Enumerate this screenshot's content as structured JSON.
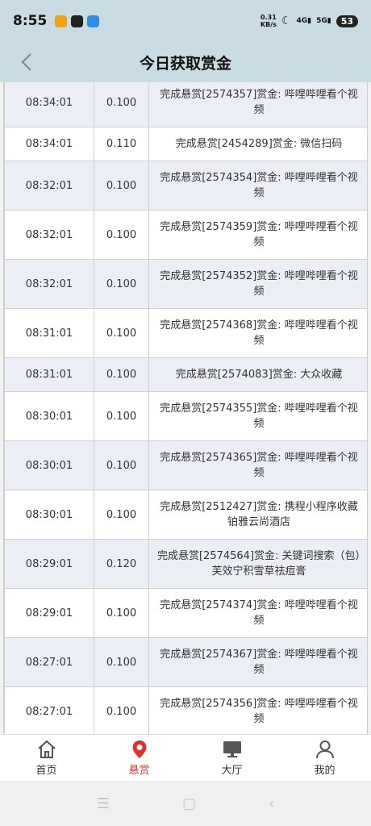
{
  "status_bar": {
    "time": "8:55",
    "net_speed_value": "0.31",
    "net_speed_unit": "KB/s",
    "signal_1": "4G",
    "signal_2": "5G",
    "battery": "53"
  },
  "header": {
    "title": "今日获取赏金"
  },
  "rows": [
    {
      "time": "08:34:01",
      "amount": "0.100",
      "desc": "完成悬赏[2574357]赏金: 哔哩哔哩看个视频"
    },
    {
      "time": "08:34:01",
      "amount": "0.110",
      "desc": "完成悬赏[2454289]赏金: 微信扫码"
    },
    {
      "time": "08:32:01",
      "amount": "0.100",
      "desc": "完成悬赏[2574354]赏金: 哔哩哔哩看个视频"
    },
    {
      "time": "08:32:01",
      "amount": "0.100",
      "desc": "完成悬赏[2574359]赏金: 哔哩哔哩看个视频"
    },
    {
      "time": "08:32:01",
      "amount": "0.100",
      "desc": "完成悬赏[2574352]赏金: 哔哩哔哩看个视频"
    },
    {
      "time": "08:31:01",
      "amount": "0.100",
      "desc": "完成悬赏[2574368]赏金: 哔哩哔哩看个视频"
    },
    {
      "time": "08:31:01",
      "amount": "0.100",
      "desc": "完成悬赏[2574083]赏金: 大众收藏"
    },
    {
      "time": "08:30:01",
      "amount": "0.100",
      "desc": "完成悬赏[2574355]赏金: 哔哩哔哩看个视频"
    },
    {
      "time": "08:30:01",
      "amount": "0.100",
      "desc": "完成悬赏[2574365]赏金: 哔哩哔哩看个视频"
    },
    {
      "time": "08:30:01",
      "amount": "0.100",
      "desc": "完成悬赏[2512427]赏金: 携程小程序收藏铂雅云尚酒店"
    },
    {
      "time": "08:29:01",
      "amount": "0.120",
      "desc": "完成悬赏[2574564]赏金: 关键词搜索（包）芙效宁积雪草祛痘膏"
    },
    {
      "time": "08:29:01",
      "amount": "0.100",
      "desc": "完成悬赏[2574374]赏金: 哔哩哔哩看个视频"
    },
    {
      "time": "08:27:01",
      "amount": "0.100",
      "desc": "完成悬赏[2574367]赏金: 哔哩哔哩看个视频"
    },
    {
      "time": "08:27:01",
      "amount": "0.100",
      "desc": "完成悬赏[2574356]赏金: 哔哩哔哩看个视频"
    }
  ],
  "tabs": [
    {
      "label": "首页",
      "icon": "home-icon",
      "active": false
    },
    {
      "label": "悬赏",
      "icon": "location-pin-icon",
      "active": true
    },
    {
      "label": "大厅",
      "icon": "monitor-icon",
      "active": false
    },
    {
      "label": "我的",
      "icon": "user-icon",
      "active": false
    }
  ],
  "colors": {
    "header_bg": "#c9dbe3",
    "row_alt_bg": "#eceef6",
    "active_tab": "#d8332f"
  }
}
